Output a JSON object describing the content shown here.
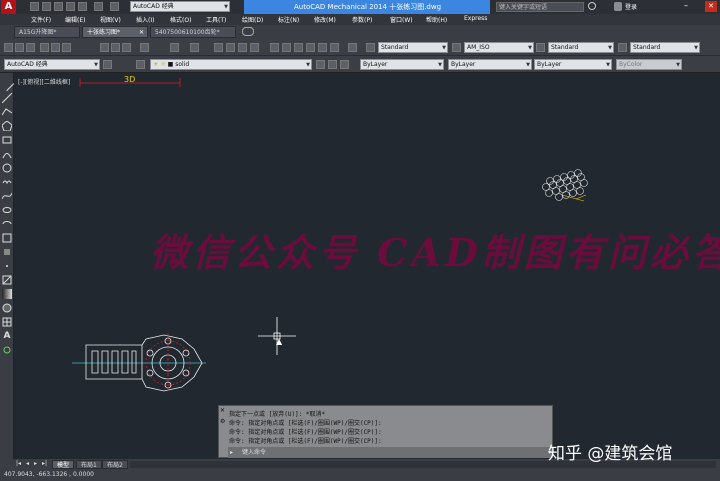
{
  "app": {
    "workspace": "AutoCAD 经典",
    "title": "AutoCAD Mechanical 2014    十张练习图.dwg",
    "search_placeholder": "键入关键字或短语",
    "login": "登录"
  },
  "menu": [
    "文件(F)",
    "编辑(E)",
    "视图(V)",
    "插入(I)",
    "格式(O)",
    "工具(T)",
    "绘图(D)",
    "标注(N)",
    "修改(M)",
    "参数(P)",
    "窗口(W)",
    "帮助(H)",
    "Express"
  ],
  "doc_tabs": [
    {
      "label": "A15G升降图*",
      "active": false
    },
    {
      "label": "十张练习图*",
      "active": true
    },
    {
      "label": "5407500610100齿轮*",
      "active": false
    }
  ],
  "toolbar1": {
    "text_style": "Standard",
    "dim_style": "AM_ISO",
    "table_style": "Standard",
    "multileader_style": "Standard"
  },
  "toolbar2": {
    "workspace": "AutoCAD 经典",
    "layer": "solid",
    "color": "ByLayer",
    "linetype": "ByLayer",
    "lineweight": "ByLayer",
    "plotstyle": "ByColor"
  },
  "viewport_label": "[-][俯视][二维线框]",
  "dim_text": "3D",
  "watermark": "微信公众号 CAD制图有问必答",
  "command": {
    "history": [
      "指定下一点或 [放弃(U)]: *取消*",
      "命令: 指定对角点或 [栏选(F)/圈围(WP)/圈交(CP)]:",
      "命令: 指定对角点或 [栏选(F)/圈围(WP)/圈交(CP)]:",
      "命令: 指定对角点或 [栏选(F)/圈围(WP)/圈交(CP)]:"
    ],
    "placeholder": "键入命令"
  },
  "layout_tabs": [
    "模型",
    "布局1",
    "布局2"
  ],
  "coords": "407.9043, -663.1326 , 0.0000",
  "zhihu_watermark": "知乎 @建筑会馆"
}
